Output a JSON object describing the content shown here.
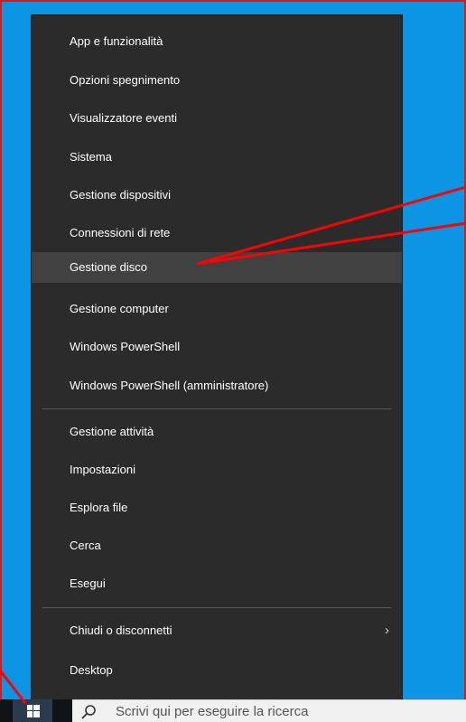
{
  "menu": {
    "items": [
      {
        "label": "App e funzionalità"
      },
      {
        "label": "Opzioni spegnimento"
      },
      {
        "label": "Visualizzatore eventi"
      },
      {
        "label": "Sistema"
      },
      {
        "label": "Gestione dispositivi"
      },
      {
        "label": "Connessioni di rete"
      },
      {
        "label": "Gestione disco",
        "highlighted": true
      },
      {
        "label": "Gestione computer"
      },
      {
        "label": "Windows PowerShell"
      },
      {
        "label": "Windows PowerShell (amministratore)"
      },
      {
        "label": "Gestione attività"
      },
      {
        "label": "Impostazioni"
      },
      {
        "label": "Esplora file"
      },
      {
        "label": "Cerca"
      },
      {
        "label": "Esegui"
      },
      {
        "label": "Chiudi o disconnetti",
        "has_submenu": true
      },
      {
        "label": "Desktop"
      }
    ]
  },
  "taskbar": {
    "start_icon": "windows-logo-icon",
    "search_icon": "search-icon",
    "search_placeholder": "Scrivi qui per eseguire la ricerca"
  },
  "colors": {
    "desktop": "#0b95e3",
    "menu_bg": "#2b2b2b",
    "menu_hover": "#414141",
    "annotation": "#ff0000"
  }
}
